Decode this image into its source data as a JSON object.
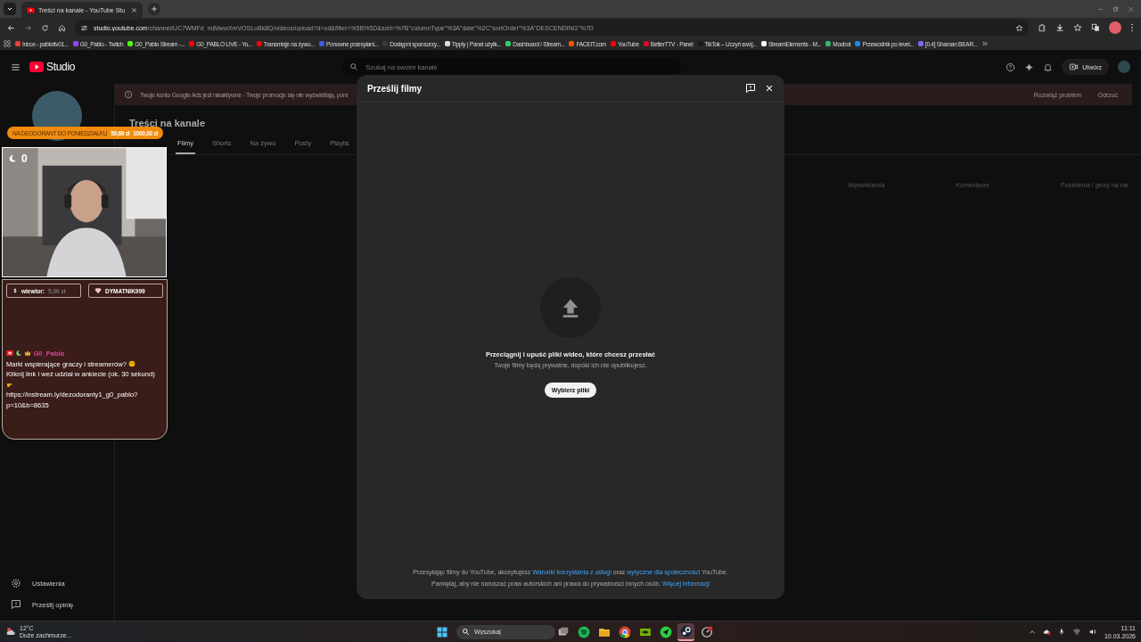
{
  "browser": {
    "tabs": [
      {
        "title": "Treści na kanale - YouTube Stu",
        "selected": true
      }
    ],
    "url": {
      "domain": "studio.youtube.com",
      "path": "/channel/UC7WMFd_mjMwwXmVOSLoBk8Q/videos/upload?d=ud&filter=%5B%5D&sort=%7B\"columnType\"%3A\"date\"%2C\"sortOrder\"%3A\"DESCENDING\"%7D"
    },
    "bookmarks": [
      {
        "label": "Inbox - pablottv01...",
        "color": "#ea4335"
      },
      {
        "label": "G0_Pablo - Twitch",
        "color": "#9146ff"
      },
      {
        "label": "G0_Pablo Stream -...",
        "color": "#53fc18"
      },
      {
        "label": "G0_PABLO LIVE - Yo...",
        "color": "#ff0000"
      },
      {
        "label": "Transmisje na żywo...",
        "color": "#ff0000"
      },
      {
        "label": "Ponowne przesyłani...",
        "color": "#3b5bdb"
      },
      {
        "label": "Dostępni sponsorzy...",
        "color": "#3a3a3a"
      },
      {
        "label": "Tipply | Panel użytk...",
        "color": "#dddddd"
      },
      {
        "label": "Dashboard / Stream...",
        "color": "#2ecc71"
      },
      {
        "label": "FACEIT.com",
        "color": "#ff5500"
      },
      {
        "label": "YouTube",
        "color": "#ff0000"
      },
      {
        "label": "BetterTTV - Panel",
        "color": "#d50f28"
      },
      {
        "label": "TikTok – Uczyń swój...",
        "color": "#1a1a1a"
      },
      {
        "label": "StreamElements - M...",
        "color": "#ffffff"
      },
      {
        "label": "Moobot",
        "color": "#3cb371"
      },
      {
        "label": "Przewodnik po level...",
        "color": "#1e88e5"
      },
      {
        "label": "[0.4] Shaman BEAR...",
        "color": "#7b68ee"
      }
    ]
  },
  "studio": {
    "logo": "Studio",
    "search": {
      "placeholder": "Szukaj na swoim kanale"
    },
    "create_button": "Utwórz",
    "banner": {
      "text": "Twoje konto Google Ads jest nieaktywne - Twoje promocje się nie wyświetlają, poni",
      "buttons": [
        "Rozwiąż problem",
        "Odrzuć"
      ]
    },
    "title": "Treści na kanale",
    "tabs": [
      {
        "label": "Filmy",
        "selected": true
      },
      {
        "label": "Shorts",
        "selected": false
      },
      {
        "label": "Na żywo",
        "selected": false
      },
      {
        "label": "Posty",
        "selected": false
      },
      {
        "label": "Playlis",
        "selected": false
      }
    ],
    "columns": [
      "Wyświetlenia",
      "Komentarze",
      "Polubienia / głosy na nie"
    ],
    "sidebar": {
      "items": [
        {
          "kind": "settings",
          "label": "Ustawienia"
        },
        {
          "kind": "feedback",
          "label": "Prześlij opinię"
        }
      ]
    }
  },
  "upload_dialog": {
    "title": "Prześlij filmy",
    "heading": "Przeciągnij i upuść pliki wideo, które chcesz przesłać",
    "subtext": "Twoje filmy będą prywatne, dopóki ich nie opublikujesz.",
    "button": "Wybierz pliki",
    "footer": [
      [
        {
          "text": "Przesyłając filmy do YouTube, akceptujesz "
        },
        {
          "link": "Warunki korzystania z usługi"
        },
        {
          "text": " oraz "
        },
        {
          "link": "wytyczne dla społeczności"
        },
        {
          "text": " YouTube."
        }
      ],
      [
        {
          "text": "Pamiętaj, aby nie naruszać praw autorskich ani prawa do prywatności innych osób. "
        },
        {
          "link": "Więcej informacji"
        }
      ]
    ]
  },
  "stream_overlay": {
    "goal": {
      "label": "NA DEODORANT DO PONIEDZIAŁKU",
      "current": "59,69 zł",
      "target": "1000,00 zł"
    },
    "webcam": {
      "counter": "0"
    },
    "events": [
      {
        "kind": "tip",
        "name": "wiewlor:",
        "amount": "5,00 zł"
      },
      {
        "kind": "follow",
        "name": "DYMATNIK999"
      }
    ],
    "chat": {
      "user": "G0_Pablo",
      "segments": [
        "Marki wspierające graczy i streamerów?",
        "Kliknij link i weź udział w ankiecie (ok. 30 sekund)",
        "https://instream.ly/dezodoranty1_g0_pablo?p=10&b=8635"
      ]
    }
  },
  "taskbar": {
    "weather": {
      "temp": "12°C",
      "description": "Duże zachmurze..."
    },
    "search": {
      "placeholder": "Wyszukaj"
    },
    "apps": [
      {
        "kind": "taskview",
        "selected": false
      },
      {
        "kind": "spotify",
        "selected": false
      },
      {
        "kind": "explorer",
        "selected": false
      },
      {
        "kind": "chrome",
        "selected": false
      },
      {
        "kind": "nvidia",
        "selected": false
      },
      {
        "kind": "arrow",
        "selected": false
      },
      {
        "kind": "steam",
        "selected": true
      },
      {
        "kind": "gauge",
        "selected": false
      }
    ],
    "time": "11:11",
    "date": "10.03.2026"
  }
}
